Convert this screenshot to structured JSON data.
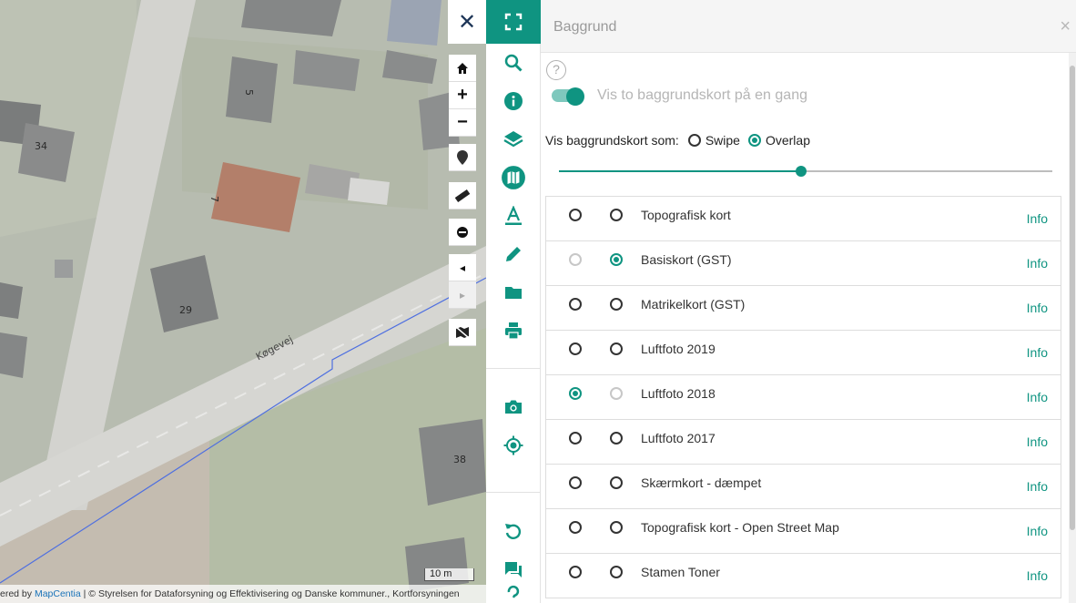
{
  "map": {
    "road_name": "Køgevej",
    "house_numbers": [
      "34",
      "5",
      "7",
      "29",
      "38"
    ],
    "scale": "10 m",
    "attribution_prefix": "ered by ",
    "attribution_link": "MapCentia",
    "attribution_rest": " | © Styrelsen for Dataforsyning og Effektivisering og Danske kommuner., Kortforsyningen"
  },
  "map_controls": {
    "close_symbol": "✕",
    "zoom_in": "+",
    "zoom_out": "−",
    "prev": "◂",
    "next": "▸"
  },
  "toolbar": {
    "items": [
      "fullscreen-icon",
      "search-icon",
      "info-icon",
      "layers-icon",
      "basemap-icon",
      "text-icon",
      "draw-icon",
      "folder-icon",
      "print-icon",
      "camera-icon",
      "locate-icon",
      "reset-icon",
      "chat-icon"
    ],
    "accent": "#0f9481"
  },
  "panel": {
    "title": "Baggrund",
    "close": "×",
    "help": "?",
    "toggle_label": "Vis to baggrundskort på en gang",
    "toggle_on": true,
    "mode_label": "Vis baggrundskort som:",
    "mode_options": [
      "Swipe",
      "Overlap"
    ],
    "mode_selected": "Overlap",
    "slider_value": 0.49,
    "info_label": "Info",
    "layers": [
      {
        "name": "Topografisk kort",
        "first": false,
        "second": false
      },
      {
        "name": "Basiskort (GST)",
        "first": false,
        "second": true
      },
      {
        "name": "Matrikelkort (GST)",
        "first": false,
        "second": false
      },
      {
        "name": "Luftfoto 2019",
        "first": false,
        "second": false
      },
      {
        "name": "Luftfoto 2018",
        "first": true,
        "second": false
      },
      {
        "name": "Luftfoto 2017",
        "first": false,
        "second": false
      },
      {
        "name": "Skærmkort - dæmpet",
        "first": false,
        "second": false
      },
      {
        "name": "Topografisk kort - Open Street Map",
        "first": false,
        "second": false
      },
      {
        "name": "Stamen Toner",
        "first": false,
        "second": false
      }
    ]
  }
}
